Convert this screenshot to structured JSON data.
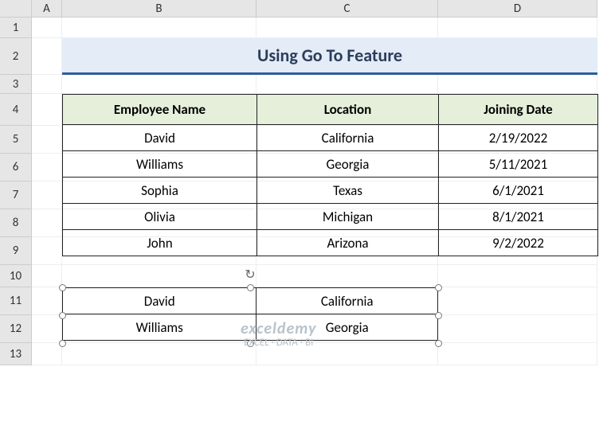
{
  "columns": [
    "A",
    "B",
    "C",
    "D"
  ],
  "col_widths": {
    "A": 38,
    "B": 244,
    "C": 228,
    "D": 200
  },
  "rows": [
    1,
    2,
    3,
    4,
    5,
    6,
    7,
    8,
    9,
    10,
    11,
    12,
    13
  ],
  "row_heights": {
    "1": 26,
    "2": 46,
    "3": 24,
    "4": 40,
    "5": 35,
    "6": 35,
    "7": 35,
    "8": 35,
    "9": 35,
    "10": 28,
    "11": 35,
    "12": 35,
    "13": 28
  },
  "title": "Using Go To Feature",
  "table": {
    "headers": [
      "Employee Name",
      "Location",
      "Joining Date"
    ],
    "rows": [
      [
        "David",
        "California",
        "2/19/2022"
      ],
      [
        "Williams",
        "Georgia",
        "5/11/2021"
      ],
      [
        "Sophia",
        "Texas",
        "6/1/2021"
      ],
      [
        "Olivia",
        "Michigan",
        "8/1/2021"
      ],
      [
        "John",
        "Arizona",
        "9/2/2022"
      ]
    ]
  },
  "picture": {
    "rows": [
      [
        "David",
        "California"
      ],
      [
        "Williams",
        "Georgia"
      ]
    ]
  },
  "watermark": {
    "brand": "exceldemy",
    "tagline": "EXCEL · DATA · BI"
  }
}
